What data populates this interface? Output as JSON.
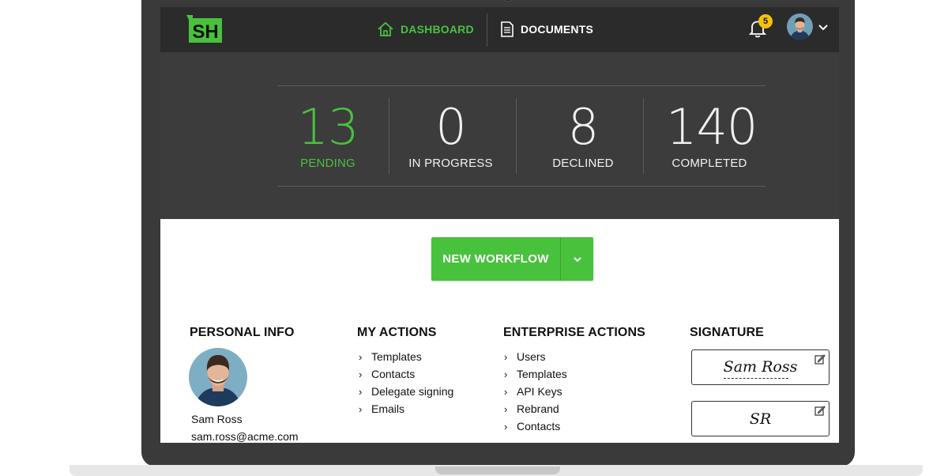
{
  "nav": {
    "logo_text": "SH",
    "dashboard_label": "DASHBOARD",
    "documents_label": "DOCUMENTS",
    "notification_count": "5",
    "accent_color": "#48c23d"
  },
  "stats": [
    {
      "value": "13",
      "label": "PENDING"
    },
    {
      "value": "0",
      "label": "IN PROGRESS"
    },
    {
      "value": "8",
      "label": "DECLINED"
    },
    {
      "value": "140",
      "label": "COMPLETED"
    }
  ],
  "workflow_button": {
    "label": "NEW WORKFLOW"
  },
  "personal_info": {
    "title": "PERSONAL INFO",
    "name": "Sam Ross",
    "email": "sam.ross@acme.com"
  },
  "my_actions": {
    "title": "MY ACTIONS",
    "items": [
      "Templates",
      "Contacts",
      "Delegate signing",
      "Emails"
    ]
  },
  "enterprise_actions": {
    "title": "ENTERPRISE ACTIONS",
    "items": [
      "Users",
      "Templates",
      "API Keys",
      "Rebrand",
      "Contacts"
    ]
  },
  "signature": {
    "title": "SIGNATURE",
    "full": "Sam Ross",
    "initials": "SR"
  }
}
